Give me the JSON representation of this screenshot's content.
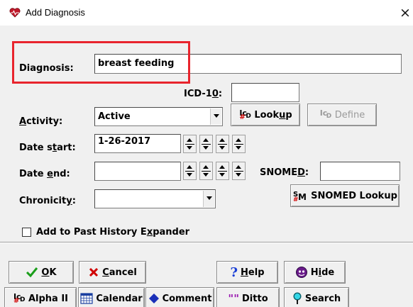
{
  "window": {
    "title": "Add Diagnosis",
    "close_glyph": "×"
  },
  "form": {
    "diagnosis": {
      "label": "Diagnosis:",
      "value": "breast feeding"
    },
    "icd10": {
      "label_pre": "ICD-1",
      "label_u": "0",
      "label_post": ":",
      "value": ""
    },
    "activity": {
      "label_u": "A",
      "label_post": "ctivity:",
      "value": "Active"
    },
    "date_start": {
      "label_pre": "Date s",
      "label_u": "t",
      "label_post": "art:",
      "value": "1-26-2017"
    },
    "date_end": {
      "label_pre": "Date ",
      "label_u": "e",
      "label_post": "nd:",
      "value": ""
    },
    "snomed": {
      "label_pre": "SNOME",
      "label_u": "D",
      "label_post": ":",
      "value": ""
    },
    "chronicity": {
      "label_pre": "Chronicit",
      "label_u": "y",
      "label_post": ":",
      "value": ""
    },
    "past_history": {
      "label_pre": "Add to Past History E",
      "label_u": "x",
      "label_post": "pander",
      "checked": false
    }
  },
  "buttons": {
    "lookup": {
      "icon": "icd-icon",
      "label_pre": "Look",
      "label_u": "u",
      "label_post": "p"
    },
    "define": {
      "icon": "icd-icon",
      "label": "Define"
    },
    "snomed_lookup": {
      "icon": "snomed-icon",
      "label": "SNOMED Lookup"
    },
    "ok": {
      "icon": "checkmark-icon",
      "label_u": "O",
      "label_post": "K"
    },
    "cancel": {
      "icon": "x-icon",
      "label_u": "C",
      "label_post": "ancel"
    },
    "help": {
      "icon": "question-icon",
      "label_u": "H",
      "label_post": "elp"
    },
    "hide": {
      "icon": "hide-icon",
      "label_pre": "H",
      "label_u": "i",
      "label_post": "de"
    },
    "alpha": {
      "icon": "icd-icon",
      "label": "Alpha II"
    },
    "calendar": {
      "icon": "calendar-icon",
      "label": "Calendar"
    },
    "comment": {
      "icon": "comment-icon",
      "label": "Comment"
    },
    "ditto": {
      "icon": "ditto-icon",
      "label": "Ditto"
    },
    "search": {
      "icon": "search-icon",
      "label": "Search"
    }
  },
  "colors": {
    "highlight_box": "#e8242d",
    "ok_check": "#1a9e1a",
    "cancel_x": "#d00000",
    "help_question": "#1a3fd6"
  }
}
